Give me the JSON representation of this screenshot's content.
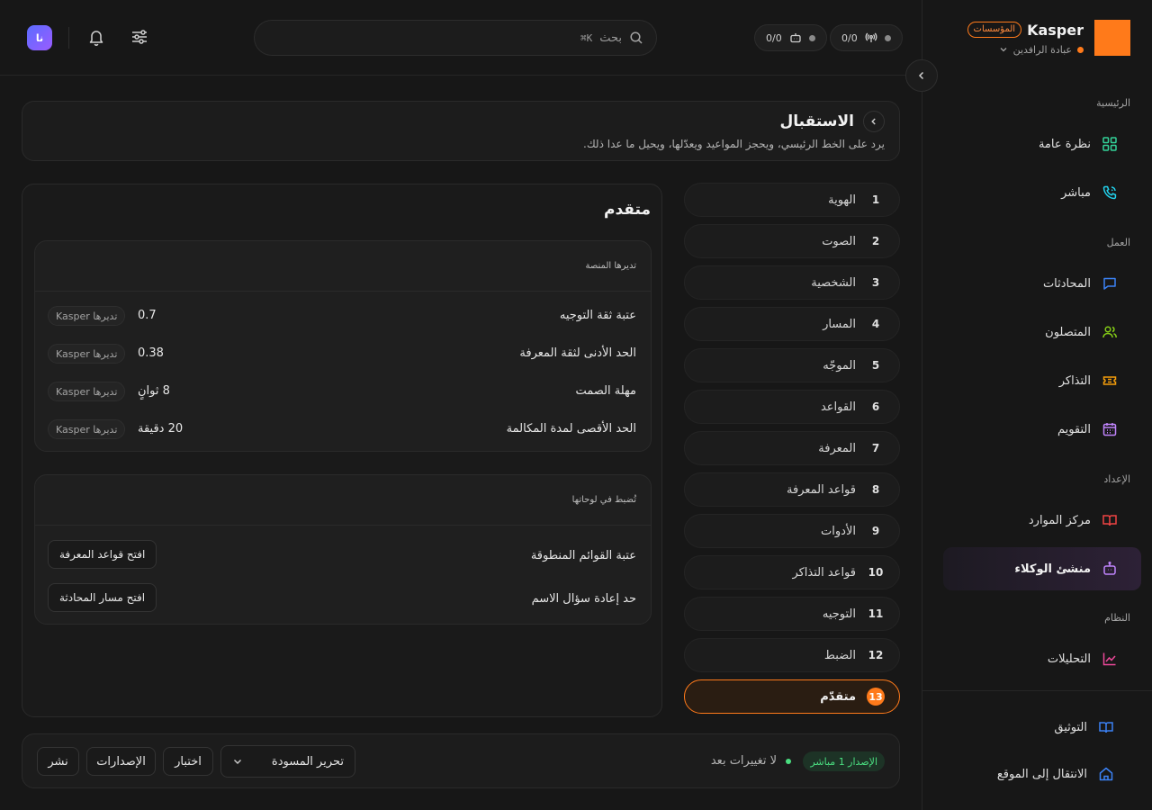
{
  "brand": {
    "name": "Kasper",
    "badge": "المؤسسات",
    "workspace": "عبادة الرافدين",
    "accent": "#ff7a1a"
  },
  "sidebar": {
    "sections": [
      {
        "label": "الرئيسية"
      },
      {
        "label": "العمل"
      },
      {
        "label": "الإعداد"
      },
      {
        "label": "النظام"
      }
    ],
    "items": [
      {
        "label": "نظرة عامة",
        "icon": "grid-icon"
      },
      {
        "label": "مباشر",
        "icon": "phone-icon"
      },
      {
        "label": "المحادثات",
        "icon": "chat-icon"
      },
      {
        "label": "المتصلون",
        "icon": "users-icon"
      },
      {
        "label": "التذاكر",
        "icon": "ticket-icon"
      },
      {
        "label": "التقويم",
        "icon": "calendar-icon"
      },
      {
        "label": "مركز الموارد",
        "icon": "book-icon"
      },
      {
        "label": "منشئ الوكلاء",
        "icon": "bot-icon",
        "active": true
      },
      {
        "label": "التحليلات",
        "icon": "chart-icon"
      }
    ],
    "bottom": [
      {
        "label": "التوثيق",
        "icon": "docs-icon"
      },
      {
        "label": "الانتقال إلى الموقع",
        "icon": "home-icon"
      }
    ]
  },
  "topbar": {
    "counter_calls": "0/0",
    "counter_bots": "0/0",
    "search_label": "بحث",
    "search_shortcut": "⌘K",
    "avatar_initials": "نا"
  },
  "header": {
    "title": "الاستقبال",
    "description": "يرد على الخط الرئيسي، ويحجز المواعيد ويعدّلها، ويحيل ما عدا ذلك."
  },
  "steps": [
    {
      "num": "1",
      "label": "الهوية"
    },
    {
      "num": "2",
      "label": "الصوت"
    },
    {
      "num": "3",
      "label": "الشخصية"
    },
    {
      "num": "4",
      "label": "المسار"
    },
    {
      "num": "5",
      "label": "الموجّه"
    },
    {
      "num": "6",
      "label": "القواعد"
    },
    {
      "num": "7",
      "label": "المعرفة"
    },
    {
      "num": "8",
      "label": "قواعد المعرفة"
    },
    {
      "num": "9",
      "label": "الأدوات"
    },
    {
      "num": "10",
      "label": "قواعد التذاكر"
    },
    {
      "num": "11",
      "label": "التوجيه"
    },
    {
      "num": "12",
      "label": "الضبط"
    },
    {
      "num": "13",
      "label": "متقدّم",
      "active": true
    }
  ],
  "advanced": {
    "title": "متقدم",
    "platform": {
      "heading": "تديرها المنصة",
      "rows": [
        {
          "label": "عتبة ثقة التوجيه",
          "value": "0.7",
          "badge": "تديرها Kasper"
        },
        {
          "label": "الحد الأدنى لثقة المعرفة",
          "value": "0.38",
          "badge": "تديرها Kasper"
        },
        {
          "label": "مهلة الصمت",
          "value": "8 ثوانٍ",
          "badge": "تديرها Kasper"
        },
        {
          "label": "الحد الأقصى لمدة المكالمة",
          "value": "20 دقيقة",
          "badge": "تديرها Kasper"
        }
      ]
    },
    "panels": {
      "heading": "تُضبط في لوحاتها",
      "rows": [
        {
          "label": "عتبة القوائم المنطوقة",
          "button": "افتح قواعد المعرفة"
        },
        {
          "label": "حد إعادة سؤال الاسم",
          "button": "افتح مسار المحادثة"
        }
      ]
    }
  },
  "footer": {
    "version": "الإصدار 1 مباشر",
    "status": "لا تغييرات بعد",
    "select_value": "تحرير المسودة",
    "test": "اختبار",
    "versions": "الإصدارات",
    "publish": "نشر"
  }
}
